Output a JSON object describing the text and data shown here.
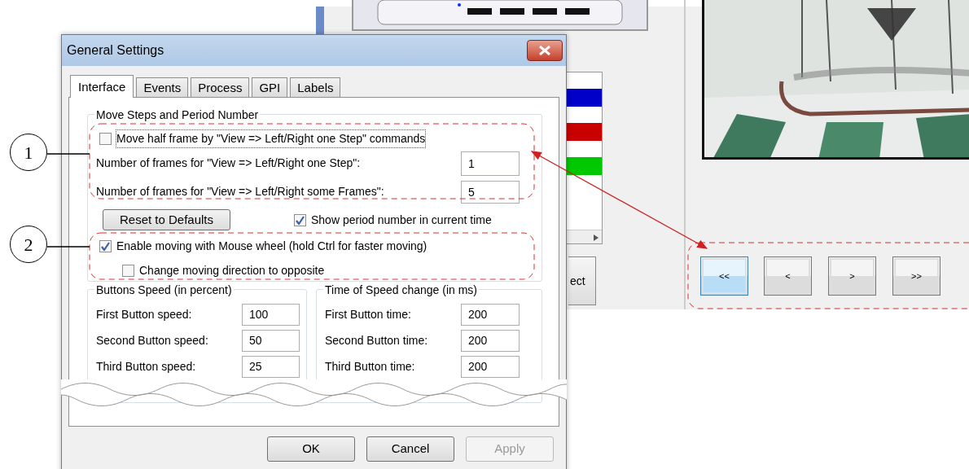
{
  "background_app": {
    "list_rows": [
      {
        "color": "#0000c8"
      },
      {
        "color": "#c80000"
      },
      {
        "color": "#00c800"
      }
    ],
    "partial_button": "ect",
    "nav_buttons": [
      {
        "label": "<<",
        "selected": true
      },
      {
        "label": "<",
        "selected": false
      },
      {
        "label": ">",
        "selected": false
      },
      {
        "label": ">>",
        "selected": false
      }
    ]
  },
  "dialog": {
    "title": "General Settings",
    "tabs": [
      {
        "label": "Interface",
        "selected": true
      },
      {
        "label": "Events",
        "selected": false
      },
      {
        "label": "Process",
        "selected": false
      },
      {
        "label": "GPI",
        "selected": false
      },
      {
        "label": "Labels",
        "selected": false
      }
    ],
    "move_group": {
      "title": "Move Steps and Period Number",
      "half_frame": {
        "label": "Move half frame by \"View => Left/Right one Step\" commands",
        "checked": false
      },
      "fields": [
        {
          "label": "Number of frames for \"View => Left/Right one Step\":",
          "value": "1"
        },
        {
          "label": "Number of frames for \"View => Left/Right some Frames\":",
          "value": "5"
        }
      ],
      "reset_button": "Reset to Defaults",
      "show_period": {
        "label": "Show period number in current time",
        "checked": true
      },
      "mouse_wheel": {
        "label": "Enable moving with Mouse wheel (hold Ctrl for faster moving)",
        "checked": true
      },
      "direction": {
        "label": "Change moving direction to opposite",
        "checked": false
      }
    },
    "speed_group": {
      "title": "Buttons Speed (in percent)",
      "rows": [
        {
          "label": "First Button speed:",
          "value": "100"
        },
        {
          "label": "Second Button speed:",
          "value": "50"
        },
        {
          "label": "Third Button speed:",
          "value": "25"
        }
      ]
    },
    "time_group": {
      "title": "Time of Speed change (in ms)",
      "rows": [
        {
          "label": "First Button time:",
          "value": "200"
        },
        {
          "label": "Second Button time:",
          "value": "200"
        },
        {
          "label": "Third Button time:",
          "value": "200"
        }
      ]
    },
    "buttons": [
      {
        "label": "OK",
        "disabled": false
      },
      {
        "label": "Cancel",
        "disabled": false
      },
      {
        "label": "Apply",
        "disabled": true
      }
    ]
  },
  "callouts": [
    {
      "number": "1"
    },
    {
      "number": "2"
    }
  ]
}
